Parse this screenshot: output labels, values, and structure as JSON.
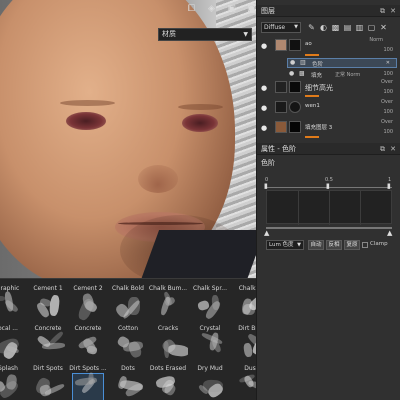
{
  "viewport": {
    "material_select": "材质"
  },
  "layers": {
    "title": "图层",
    "channel": "Diffuse",
    "items": [
      {
        "name": "ao",
        "blend": "Norm",
        "opacity": "100",
        "sub": [
          {
            "name": "色阶"
          },
          {
            "name": "填充",
            "blend": "正常 Norm",
            "opacity": "100"
          }
        ]
      },
      {
        "name": "细节高光",
        "blend": "Over",
        "opacity": "100"
      },
      {
        "name": "wen1",
        "blend": "Over",
        "opacity": "100"
      },
      {
        "name": "填充图层 3",
        "blend": "Over",
        "opacity": "100"
      }
    ]
  },
  "properties": {
    "title": "属性 - 色阶",
    "section": "色阶",
    "levels": {
      "input_black": "0",
      "gamma": "0.5",
      "input_white": "1"
    },
    "mode": "Lum 色度",
    "buttons": [
      "自动",
      "反相",
      "复原"
    ],
    "clamp": "Clamp"
  },
  "shelf": {
    "rows": [
      [
        "graphic",
        "Cement 1",
        "Cement 2",
        "Chalk Bold",
        "Chalk Bum...",
        "Chalk Spr...",
        "Chalk S"
      ],
      [
        "ocal ...",
        "Concrete",
        "Concrete",
        "Cotton",
        "Cracks",
        "Crystal",
        "Dirt Bru"
      ],
      [
        "Splash",
        "Dirt Spots",
        "Dirt Spots ...",
        "Dots",
        "Dots Erased",
        "Dry Mud",
        "Dus"
      ]
    ],
    "selected": {
      "row": 2,
      "col": 2
    }
  }
}
